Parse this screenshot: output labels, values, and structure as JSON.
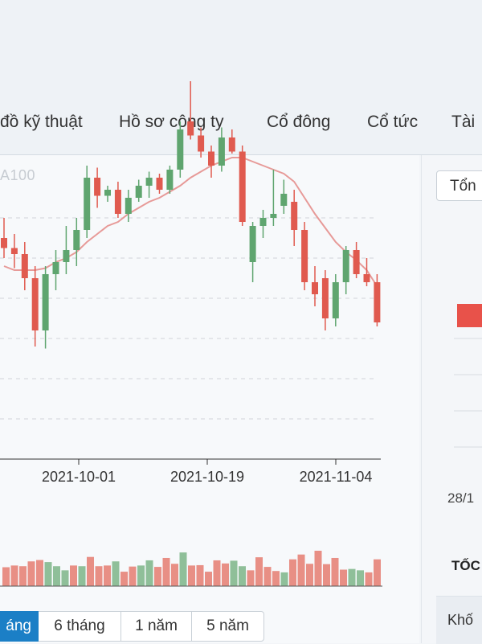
{
  "tabs": [
    {
      "label": "đồ kỹ thuật"
    },
    {
      "label": "Hồ sơ công ty"
    },
    {
      "label": "Cổ đông"
    },
    {
      "label": "Cổ tức"
    },
    {
      "label": "Tài"
    }
  ],
  "overlay_label": "A100",
  "range_buttons": [
    {
      "label": "áng",
      "active": true
    },
    {
      "label": "6 tháng",
      "active": false
    },
    {
      "label": "1 năm",
      "active": false
    },
    {
      "label": "5 năm",
      "active": false
    }
  ],
  "right_panel": {
    "select_value": "Tổn",
    "date_label": "28/1",
    "section_title": "TỐC",
    "row_label": "Khố"
  },
  "colors": {
    "up": "#8fbf99",
    "up_candle": "#5fa56f",
    "down": "#e05a4f",
    "down_volume": "#e88f85",
    "ma_line": "#e79a98",
    "grid": "#d0d4d8",
    "right_bar": "#e8524a"
  },
  "chart_data": {
    "type": "candlestick",
    "x_ticks": [
      "2021-10-01",
      "2021-10-19",
      "2021-11-04"
    ],
    "candles": [
      {
        "o": 101.0,
        "h": 102.0,
        "l": 100.0,
        "c": 100.5
      },
      {
        "o": 100.5,
        "h": 101.2,
        "l": 99.5,
        "c": 100.2
      },
      {
        "o": 100.2,
        "h": 100.8,
        "l": 98.4,
        "c": 99.0
      },
      {
        "o": 99.0,
        "h": 99.6,
        "l": 95.6,
        "c": 96.4
      },
      {
        "o": 96.4,
        "h": 99.6,
        "l": 95.5,
        "c": 99.2
      },
      {
        "o": 99.2,
        "h": 100.4,
        "l": 98.4,
        "c": 99.8
      },
      {
        "o": 99.8,
        "h": 101.6,
        "l": 99.2,
        "c": 100.4
      },
      {
        "o": 100.4,
        "h": 102.0,
        "l": 99.6,
        "c": 101.4
      },
      {
        "o": 101.4,
        "h": 104.6,
        "l": 101.0,
        "c": 104.0
      },
      {
        "o": 104.0,
        "h": 104.5,
        "l": 102.5,
        "c": 103.1
      },
      {
        "o": 103.1,
        "h": 103.6,
        "l": 102.8,
        "c": 103.4
      },
      {
        "o": 103.4,
        "h": 103.8,
        "l": 102.0,
        "c": 102.2
      },
      {
        "o": 102.2,
        "h": 103.4,
        "l": 101.8,
        "c": 103.0
      },
      {
        "o": 103.0,
        "h": 103.9,
        "l": 102.8,
        "c": 103.6
      },
      {
        "o": 103.6,
        "h": 104.3,
        "l": 103.0,
        "c": 104.0
      },
      {
        "o": 104.0,
        "h": 104.2,
        "l": 103.2,
        "c": 103.4
      },
      {
        "o": 103.4,
        "h": 104.6,
        "l": 103.2,
        "c": 104.4
      },
      {
        "o": 104.4,
        "h": 106.8,
        "l": 104.0,
        "c": 106.4
      },
      {
        "o": 106.8,
        "h": 108.8,
        "l": 105.9,
        "c": 106.1
      },
      {
        "o": 106.1,
        "h": 106.5,
        "l": 105.0,
        "c": 105.3
      },
      {
        "o": 105.3,
        "h": 105.6,
        "l": 104.0,
        "c": 104.6
      },
      {
        "o": 104.6,
        "h": 106.5,
        "l": 104.3,
        "c": 106.0
      },
      {
        "o": 106.0,
        "h": 106.4,
        "l": 105.2,
        "c": 105.3
      },
      {
        "o": 105.3,
        "h": 105.6,
        "l": 101.6,
        "c": 101.8
      },
      {
        "o": 99.8,
        "h": 101.8,
        "l": 98.8,
        "c": 101.6
      },
      {
        "o": 101.6,
        "h": 102.4,
        "l": 101.0,
        "c": 102.0
      },
      {
        "o": 102.0,
        "h": 104.4,
        "l": 101.6,
        "c": 102.2
      },
      {
        "o": 102.6,
        "h": 103.9,
        "l": 102.2,
        "c": 103.2
      },
      {
        "o": 102.8,
        "h": 103.4,
        "l": 100.6,
        "c": 101.4
      },
      {
        "o": 101.4,
        "h": 101.8,
        "l": 98.4,
        "c": 98.8
      },
      {
        "o": 98.8,
        "h": 99.6,
        "l": 97.6,
        "c": 98.2
      },
      {
        "o": 99.0,
        "h": 99.4,
        "l": 96.4,
        "c": 97.0
      },
      {
        "o": 97.0,
        "h": 99.2,
        "l": 96.6,
        "c": 98.8
      },
      {
        "o": 98.8,
        "h": 100.6,
        "l": 98.2,
        "c": 100.4
      },
      {
        "o": 100.4,
        "h": 100.8,
        "l": 99.0,
        "c": 99.2
      },
      {
        "o": 99.2,
        "h": 100.0,
        "l": 98.6,
        "c": 98.8
      },
      {
        "o": 98.8,
        "h": 99.2,
        "l": 96.6,
        "c": 96.8
      }
    ],
    "ma": [
      99.6,
      99.4,
      99.4,
      99.4,
      99.5,
      99.8,
      100.0,
      100.3,
      100.8,
      101.2,
      101.6,
      101.8,
      102.2,
      102.5,
      102.8,
      103.0,
      103.3,
      103.6,
      104.0,
      104.3,
      104.6,
      104.8,
      105.0,
      105.0,
      104.8,
      104.6,
      104.4,
      104.2,
      103.8,
      103.0,
      102.2,
      101.5,
      100.8,
      100.3,
      99.9,
      99.4,
      98.6
    ],
    "volumes": [
      55,
      60,
      58,
      72,
      76,
      70,
      58,
      46,
      60,
      58,
      85,
      58,
      60,
      72,
      42,
      57,
      60,
      75,
      56,
      82,
      65,
      98,
      60,
      61,
      42,
      75,
      66,
      74,
      58,
      46,
      84,
      56,
      44,
      40,
      78,
      92,
      65,
      103,
      64,
      82,
      48,
      50,
      46,
      40,
      78
    ]
  }
}
